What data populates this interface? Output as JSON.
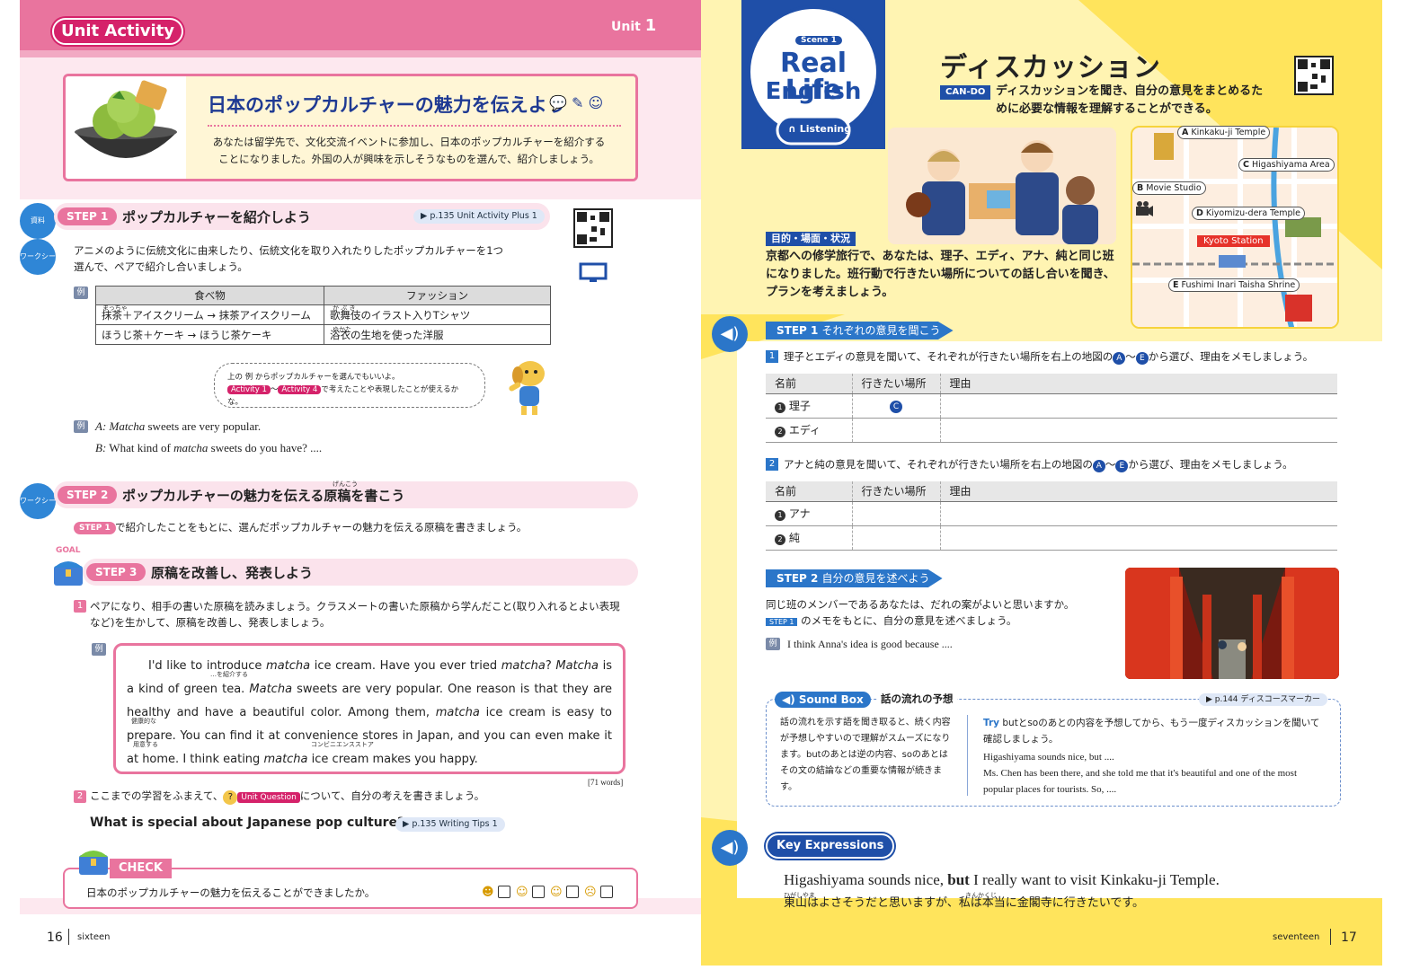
{
  "left": {
    "header": {
      "badge": "Unit Activity",
      "unit_label": "Unit",
      "unit_number": "1"
    },
    "intro": {
      "title": "日本のポップカルチャーの魅力を伝えよう",
      "text": "あなたは留学先で、文化交流イベントに参加し、日本のポップカルチャーを紹介することになりました。外国の人が興味を示しそうなものを選んで、紹介しましょう。"
    },
    "step1": {
      "pill": "STEP 1",
      "title": "ポップカルチャーを紹介しよう",
      "ref": "▶ p.135 Unit Activity Plus 1",
      "icon1": "資料",
      "icon2": "ワークシート",
      "text": "アニメのように伝統文化に由来したり、伝統文化を取り入れたりしたポップカルチャーを1つ選んで、ペアで紹介し合いましょう。",
      "rei": "例",
      "table": {
        "headers": [
          "食べ物",
          "ファッション"
        ],
        "rows": [
          [
            "抹茶＋アイスクリーム → 抹茶アイスクリーム",
            "歌舞伎のイラスト入りTシャツ"
          ],
          [
            "ほうじ茶＋ケーキ → ほうじ茶ケーキ",
            "浴衣の生地を使った洋服"
          ]
        ],
        "ruby1": "まっちゃ",
        "ruby2": "か ぶ き",
        "ruby3": "ゆかた"
      },
      "speech_line1": "上の 例 からポップカルチャーを選んでもいいよ。",
      "speech_a1": "Activity 1",
      "speech_tilde": "〜",
      "speech_a4": "Activity 4",
      "speech_line2": "で考えたことや表現したことが使えるかな。",
      "dialog_rei": "例",
      "dialog_a_label": "A:",
      "dialog_a_italic": "Matcha",
      "dialog_a_rest": "sweets are very popular.",
      "dialog_b_label": "B:",
      "dialog_b_pre": "What kind of",
      "dialog_b_italic": "matcha",
      "dialog_b_post": "sweets do you have?  ...."
    },
    "step2": {
      "pill": "STEP 2",
      "title": "ポップカルチャーの魅力を伝える原稿を書こう",
      "ruby": "げんこう",
      "icon": "ワークシート",
      "mini_pill": "STEP 1",
      "text": "で紹介したことをもとに、選んだポップカルチャーの魅力を伝える原稿を書きましょう。"
    },
    "step3": {
      "goal": "GOAL",
      "pill": "STEP 3",
      "title": "原稿を改善し、発表しよう",
      "item1_num": "1",
      "item1": "ペアになり、相手の書いた原稿を読みましょう。クラスメートの書いた原稿から学んだこと(取り入れるとよい表現など)を生かして、原稿を改善し、発表しましょう。",
      "rei": "例",
      "example": "I'd like to introduce matcha ice cream.  Have you ever tried matcha?  Matcha is a kind of green tea.  Matcha sweets are very popular.  One reason is that they are healthy and have a beautiful color.  Among them, matcha ice cream is easy to prepare.  You can find it at convenience stores in Japan, and you can even make it at home.  I think eating matcha ice cream makes you happy.",
      "gloss1": "…を紹介する",
      "gloss2": "健康的な",
      "gloss3": "用意する",
      "gloss4": "コンビニエンスストア",
      "word_count": "[71 words]",
      "item2_num": "2",
      "item2_pre": "ここまでの学習をふまえて、",
      "uq_badge": "Unit Question",
      "item2_post": "について、自分の考えを書きましょう。",
      "question": "What is special about Japanese pop culture?",
      "question_ref": "▶ p.135 Writing Tips 1"
    },
    "check": {
      "label": "CHECK",
      "text": "日本のポップカルチャーの魅力を伝えることができましたか。"
    },
    "footer": {
      "page_number": "16",
      "page_word": "sixteen"
    }
  },
  "right": {
    "badge": {
      "scene": "Scene 1",
      "line1": "Real Life",
      "line2": "English",
      "listening": "Listening"
    },
    "title": "ディスカッション",
    "cando_label": "CAN-DO",
    "cando_text": "ディスカッションを聞き、自分の意見をまとめるために必要な情報を理解することができる。",
    "map": {
      "a": "Kinkaku-ji Temple",
      "b": "Movie Studio",
      "c": "Higashiyama Area",
      "d": "Kiyomizu-dera Temple",
      "e": "Fushimi Inari Taisha Shrine",
      "station": "Kyoto Station",
      "a_letter": "A",
      "b_letter": "B",
      "c_letter": "C",
      "d_letter": "D",
      "e_letter": "E"
    },
    "situation_tag": "目的・場面・状況",
    "situation_text": "京都への修学旅行で、あなたは、理子、エディ、アナ、純と同じ班になりました。班行動で行きたい場所についての話し合いを聞き、プランを考えましょう。",
    "step1": {
      "pill": "STEP 1",
      "title": "それぞれの意見を聞こう",
      "item1_num": "1",
      "item1_pre": "理子とエディの意見を聞いて、それぞれが行きたい場所を右上の地図の",
      "item1_post": "から選び、理由をメモしましょう。",
      "range_a": "A",
      "range_tilde": "〜",
      "range_e": "E",
      "table1": {
        "headers": [
          "名前",
          "行きたい場所",
          "理由"
        ],
        "rows": [
          {
            "num": "1",
            "name": "理子",
            "place": "C",
            "reason": ""
          },
          {
            "num": "2",
            "name": "エディ",
            "place": "",
            "reason": ""
          }
        ]
      },
      "item2_num": "2",
      "item2_pre": "アナと純の意見を聞いて、それぞれが行きたい場所を右上の地図の",
      "item2_post": "から選び、理由をメモしましょう。",
      "table2": {
        "headers": [
          "名前",
          "行きたい場所",
          "理由"
        ],
        "rows": [
          {
            "num": "1",
            "name": "アナ",
            "place": "",
            "reason": ""
          },
          {
            "num": "2",
            "name": "純",
            "place": "",
            "reason": ""
          }
        ]
      }
    },
    "step2": {
      "pill": "STEP 2",
      "title": "自分の意見を述べよう",
      "text1": "同じ班のメンバーであるあなたは、だれの案がよいと思いますか。",
      "mini_pill": "STEP 1",
      "text2": "のメモをもとに、自分の意見を述べましょう。",
      "rei": "例",
      "example": "I think Anna's idea is good because ...."
    },
    "soundbox": {
      "badge": "Sound Box",
      "title": "話の流れの予想",
      "ref": "▶ p.144 ディスコースマーカー",
      "left_text": "話の流れを示す語を聞き取ると、続く内容が予想しやすいので理解がスムーズになります。butのあとは逆の内容、soのあとはその文の結論などの重要な情報が続きます。",
      "try_label": "Try",
      "try_text": "butとsoのあとの内容を予想してから、もう一度ディスカッションを聞いて確認しましょう。",
      "line1": "Higashiyama sounds nice, but ....",
      "line2": "Ms. Chen has been there, and she told me that it's beautiful and one of the most popular places for tourists.  So, ...."
    },
    "key": {
      "badge": "Key Expressions",
      "en_pre": "Higashiyama sounds nice,",
      "en_bold": "but",
      "en_post": "I really want to visit Kinkaku-ji Temple.",
      "ja": "東山はよさそうだと思いますが、私は本当に金閣寺に行きたいです。",
      "ruby1": "ひがしやま",
      "ruby2": "きんかくじ"
    },
    "footer": {
      "page_word": "seventeen",
      "page_number": "17"
    }
  },
  "colors": {
    "pink": "#e9749e",
    "blue": "#2b76c9",
    "navy": "#1f4fa8",
    "yellow": "#fff4b2"
  }
}
